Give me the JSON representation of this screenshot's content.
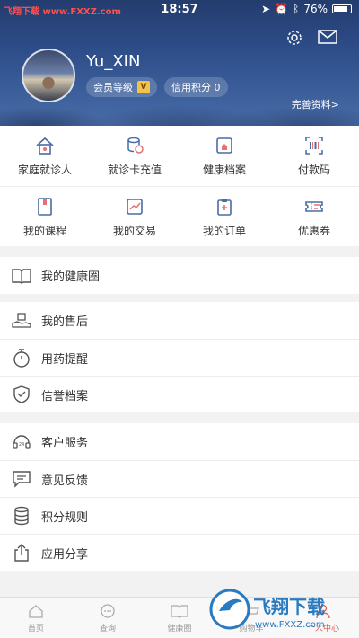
{
  "status_bar": {
    "brand": "飞翔下载",
    "brand_url": "www.FXXZ.com",
    "time": "18:57",
    "battery": "76%"
  },
  "profile": {
    "username": "Yu_XIN",
    "member_level_label": "会员等级",
    "credit_label": "信用积分 0",
    "complete_link": "完善资料>"
  },
  "grid": {
    "row1": [
      {
        "label": "家庭就诊人",
        "icon": "house-icon"
      },
      {
        "label": "就诊卡充值",
        "icon": "coins-icon"
      },
      {
        "label": "健康档案",
        "icon": "folder-icon"
      },
      {
        "label": "付款码",
        "icon": "barcode-icon"
      }
    ],
    "row2": [
      {
        "label": "我的课程",
        "icon": "book-icon"
      },
      {
        "label": "我的交易",
        "icon": "chart-icon"
      },
      {
        "label": "我的订单",
        "icon": "clipboard-icon"
      },
      {
        "label": "优惠券",
        "icon": "ticket-icon"
      }
    ]
  },
  "menu": {
    "health_circle": "我的健康圈",
    "after_sales": "我的售后",
    "medication_reminder": "用药提醒",
    "credit_record": "信誉档案",
    "customer_service": "客户服务",
    "feedback": "意见反馈",
    "points_rules": "积分规则",
    "share_app": "应用分享"
  },
  "tabbar": {
    "home": "首页",
    "query": "查询",
    "health_circle": "健康圈",
    "fourth": "购物车",
    "mine": "个人中心"
  },
  "watermark": {
    "title": "飞翔下载",
    "url": "www.FXXZ.com"
  },
  "colors": {
    "header_blue": "#2c4b86",
    "icon_blue": "#4a6ca6",
    "brand_red": "#ff4f4f"
  }
}
